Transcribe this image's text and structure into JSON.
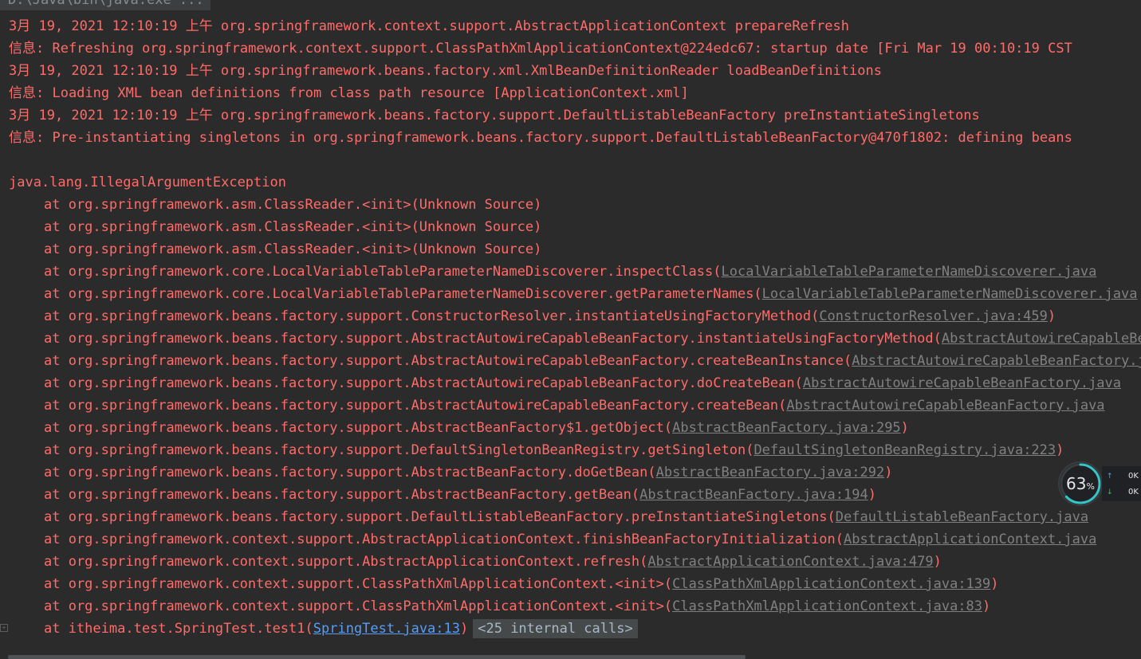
{
  "console": {
    "command": "D:\\Java\\bin\\java.exe ...",
    "log_lines": [
      "3月 19, 2021 12:10:19 上午 org.springframework.context.support.AbstractApplicationContext prepareRefresh",
      "信息: Refreshing org.springframework.context.support.ClassPathXmlApplicationContext@224edc67: startup date [Fri Mar 19 00:10:19 CST",
      "3月 19, 2021 12:10:19 上午 org.springframework.beans.factory.xml.XmlBeanDefinitionReader loadBeanDefinitions",
      "信息: Loading XML bean definitions from class path resource [ApplicationContext.xml]",
      "3月 19, 2021 12:10:19 上午 org.springframework.beans.factory.support.DefaultListableBeanFactory preInstantiateSingletons",
      "信息: Pre-instantiating singletons in org.springframework.beans.factory.support.DefaultListableBeanFactory@470f1802: defining beans"
    ],
    "exception": "java.lang.IllegalArgumentException",
    "stack": [
      {
        "text": "at org.springframework.asm.ClassReader.<init>(Unknown Source)",
        "link": "",
        "close": ""
      },
      {
        "text": "at org.springframework.asm.ClassReader.<init>(Unknown Source)",
        "link": "",
        "close": ""
      },
      {
        "text": "at org.springframework.asm.ClassReader.<init>(Unknown Source)",
        "link": "",
        "close": ""
      },
      {
        "text": "at org.springframework.core.LocalVariableTableParameterNameDiscoverer.inspectClass(",
        "link": "LocalVariableTableParameterNameDiscoverer.java",
        "close": ""
      },
      {
        "text": "at org.springframework.core.LocalVariableTableParameterNameDiscoverer.getParameterNames(",
        "link": "LocalVariableTableParameterNameDiscoverer.java",
        "close": ""
      },
      {
        "text": "at org.springframework.beans.factory.support.ConstructorResolver.instantiateUsingFactoryMethod(",
        "link": "ConstructorResolver.java:459",
        "close": ")"
      },
      {
        "text": "at org.springframework.beans.factory.support.AbstractAutowireCapableBeanFactory.instantiateUsingFactoryMethod(",
        "link": "AbstractAutowireCapableBeanFactory.java",
        "close": ""
      },
      {
        "text": "at org.springframework.beans.factory.support.AbstractAutowireCapableBeanFactory.createBeanInstance(",
        "link": "AbstractAutowireCapableBeanFactory.java",
        "close": ""
      },
      {
        "text": "at org.springframework.beans.factory.support.AbstractAutowireCapableBeanFactory.doCreateBean(",
        "link": "AbstractAutowireCapableBeanFactory.java",
        "close": ""
      },
      {
        "text": "at org.springframework.beans.factory.support.AbstractAutowireCapableBeanFactory.createBean(",
        "link": "AbstractAutowireCapableBeanFactory.java",
        "close": ""
      },
      {
        "text": "at org.springframework.beans.factory.support.AbstractBeanFactory$1.getObject(",
        "link": "AbstractBeanFactory.java:295",
        "close": ")"
      },
      {
        "text": "at org.springframework.beans.factory.support.DefaultSingletonBeanRegistry.getSingleton(",
        "link": "DefaultSingletonBeanRegistry.java:223",
        "close": ")"
      },
      {
        "text": "at org.springframework.beans.factory.support.AbstractBeanFactory.doGetBean(",
        "link": "AbstractBeanFactory.java:292",
        "close": ")"
      },
      {
        "text": "at org.springframework.beans.factory.support.AbstractBeanFactory.getBean(",
        "link": "AbstractBeanFactory.java:194",
        "close": ")"
      },
      {
        "text": "at org.springframework.beans.factory.support.DefaultListableBeanFactory.preInstantiateSingletons(",
        "link": "DefaultListableBeanFactory.java",
        "close": ""
      },
      {
        "text": "at org.springframework.context.support.AbstractApplicationContext.finishBeanFactoryInitialization(",
        "link": "AbstractApplicationContext.java",
        "close": ""
      },
      {
        "text": "at org.springframework.context.support.AbstractApplicationContext.refresh(",
        "link": "AbstractApplicationContext.java:479",
        "close": ")"
      },
      {
        "text": "at org.springframework.context.support.ClassPathXmlApplicationContext.<init>(",
        "link": "ClassPathXmlApplicationContext.java:139",
        "close": ")"
      },
      {
        "text": "at org.springframework.context.support.ClassPathXmlApplicationContext.<init>(",
        "link": "ClassPathXmlApplicationContext.java:83",
        "close": ")"
      }
    ],
    "last_frame": {
      "text": "at itheima.test.SpringTest.test1(",
      "link": "SpringTest.java:13",
      "close": ")",
      "internal_calls": "<25 internal calls>"
    },
    "fold_icon": "plus-icon"
  },
  "system_widget": {
    "cpu_percent": 63,
    "cpu_value": "63",
    "cpu_unit": "%",
    "upload": "0K",
    "download": "0K",
    "colors": {
      "ring_active": "#35c4c8",
      "ring_track": "#3a3d40",
      "upload_arrow": "#3fa9f5",
      "download_arrow": "#35c46a"
    }
  },
  "colors": {
    "background": "#2b2b2b",
    "error_text": "#ff6b68",
    "source_link": "#808080",
    "user_link": "#589df6"
  }
}
